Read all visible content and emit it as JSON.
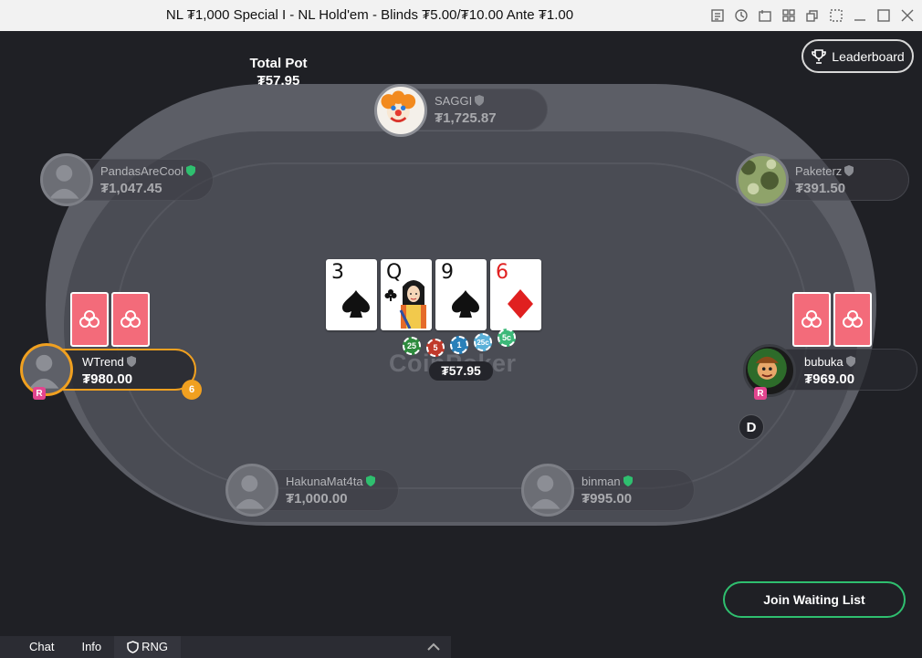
{
  "window": {
    "title": "NL ₮1,000 Special I - NL Hold'em - Blinds ₮5.00/₮10.00 Ante ₮1.00",
    "controls": [
      "notes-icon",
      "history-icon",
      "lobby-icon",
      "tile-icon",
      "cascade-icon",
      "fullscreen-icon",
      "minimize-icon",
      "maximize-icon",
      "close-icon"
    ]
  },
  "pot": {
    "label": "Total Pot",
    "total": "₮57.95",
    "center": "₮57.95"
  },
  "leaderboard": {
    "label": "Leaderboard"
  },
  "watermark": "CoinPoker",
  "board": [
    {
      "rank": "3",
      "suit": "spade",
      "color": "black"
    },
    {
      "rank": "Q",
      "suit": "club",
      "color": "black",
      "face": true
    },
    {
      "rank": "9",
      "suit": "spade",
      "color": "black"
    },
    {
      "rank": "6",
      "suit": "diamond",
      "color": "red"
    }
  ],
  "chips": [
    {
      "label": "25",
      "color": "#2e8b3e"
    },
    {
      "label": "5",
      "color": "#c0392b"
    },
    {
      "label": "1",
      "color": "#2980b9"
    },
    {
      "label": "25c",
      "color": "#5ab0d8"
    },
    {
      "label": "5c",
      "color": "#3cb878"
    }
  ],
  "seats": {
    "saggi": {
      "name": "SAGGI",
      "stack": "₮1,725.87"
    },
    "pandas": {
      "name": "PandasAreCool",
      "stack": "₮1,047.45"
    },
    "paketerz": {
      "name": "Paketerz",
      "stack": "₮391.50"
    },
    "wtrend": {
      "name": "WTrend",
      "stack": "₮980.00",
      "timer": "6",
      "rng": "R"
    },
    "bubuka": {
      "name": "bubuka",
      "stack": "₮969.00",
      "rng": "R"
    },
    "hakuna": {
      "name": "HakunaMat4ta",
      "stack": "₮1,000.00"
    },
    "binman": {
      "name": "binman",
      "stack": "₮995.00"
    }
  },
  "dealer": "D",
  "join_button": "Join Waiting List",
  "tabs": [
    "Chat",
    "Info",
    "RNG"
  ],
  "colors": {
    "accent_green": "#2fbf6f",
    "card_back": "#f36b7a",
    "active_ring": "#f0a020",
    "rng_badge": "#e3458f"
  }
}
